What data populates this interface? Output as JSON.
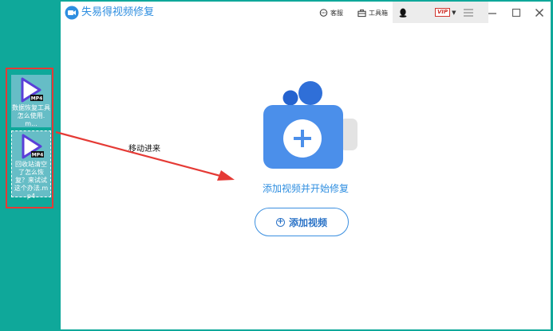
{
  "desktop": {
    "files": [
      {
        "name": "数据恢复工具怎么使用.m...",
        "badge": "MP4"
      },
      {
        "name": "回收站清空了怎么恢复？来试试这个办法.mp4",
        "badge": "MP4"
      }
    ],
    "annotation": "移动进来"
  },
  "app": {
    "title": "失易得视频修复",
    "toolbar": {
      "support_label": "客服",
      "toolbox_label": "工具箱",
      "vip_label": "VIP"
    },
    "main": {
      "prompt_text": "添加视频并开始修复",
      "add_button_label": "添加视频"
    }
  },
  "colors": {
    "desktop_bg": "#0fa89a",
    "accent": "#2e8ee0",
    "annotation_red": "#e53a35"
  }
}
